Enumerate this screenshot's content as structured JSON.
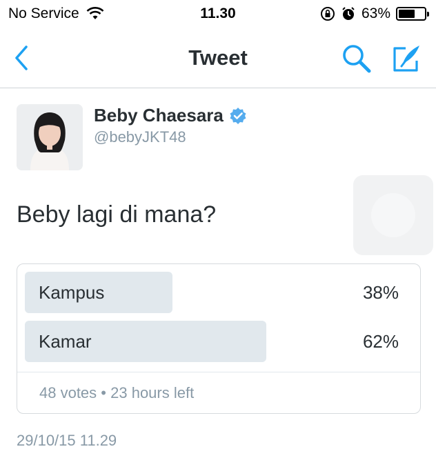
{
  "status_bar": {
    "carrier": "No Service",
    "time": "11.30",
    "battery": "63%",
    "battery_level": 0.63
  },
  "nav": {
    "title": "Tweet",
    "back_icon": "chevron-left-icon",
    "search_icon": "search-icon",
    "compose_icon": "compose-icon",
    "accent": "#1da1f2"
  },
  "tweet": {
    "author_name": "Beby Chaesara",
    "author_handle": "@bebyJKT48",
    "verified": true,
    "text": "Beby lagi di mana?",
    "timestamp": "29/10/15 11.29"
  },
  "poll": {
    "options": [
      {
        "label": "Kampus",
        "percent": "38%",
        "value": 0.38
      },
      {
        "label": "Kamar",
        "percent": "62%",
        "value": 0.62
      }
    ],
    "votes": "48 votes",
    "time_left": "23 hours left",
    "separator": "•"
  }
}
